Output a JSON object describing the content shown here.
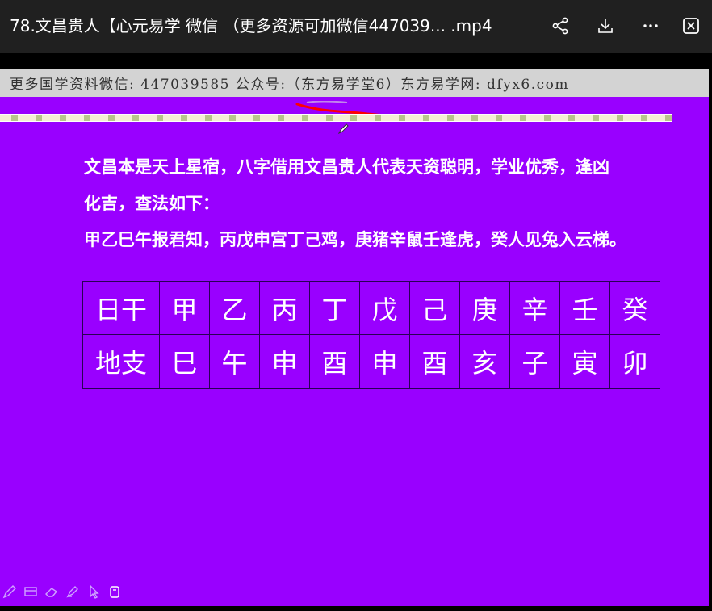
{
  "window": {
    "title": "78.文昌贵人【心元易学 微信 （更多资源可加微信447039... .mp4"
  },
  "toolbar": {
    "share_icon": "share-icon",
    "download_icon": "download-icon",
    "more_icon": "more-icon",
    "edge_icon": "edge-icon"
  },
  "slide": {
    "watermark": "更多国学资料微信: 447039585 公众号:（东方易学堂6）东方易学网: dfyx6.com",
    "paragraph_1": "文昌本是天上星宿，八字借用文昌贵人代表天资聪明，学业优秀，逢凶",
    "paragraph_2": "化吉，查法如下：",
    "paragraph_3": "甲乙巳午报君知，丙戊申宫丁己鸡，庚猪辛鼠壬逢虎，癸人见兔入云梯。",
    "table": {
      "row_1": [
        "日干",
        "甲",
        "乙",
        "丙",
        "丁",
        "戊",
        "己",
        "庚",
        "辛",
        "壬",
        "癸"
      ],
      "row_2": [
        "地支",
        "巳",
        "午",
        "申",
        "酉",
        "申",
        "酉",
        "亥",
        "子",
        "寅",
        "卯"
      ]
    }
  },
  "annotation_tools": [
    "pen-icon",
    "screen-icon",
    "eraser-icon",
    "highlighter-icon",
    "pointer-icon",
    "clear-icon"
  ],
  "colors": {
    "slide_background": "#9900ff",
    "title_bar": "#202020",
    "watermark_bar": "#d3d3d3",
    "scribble": "#ff0000"
  }
}
